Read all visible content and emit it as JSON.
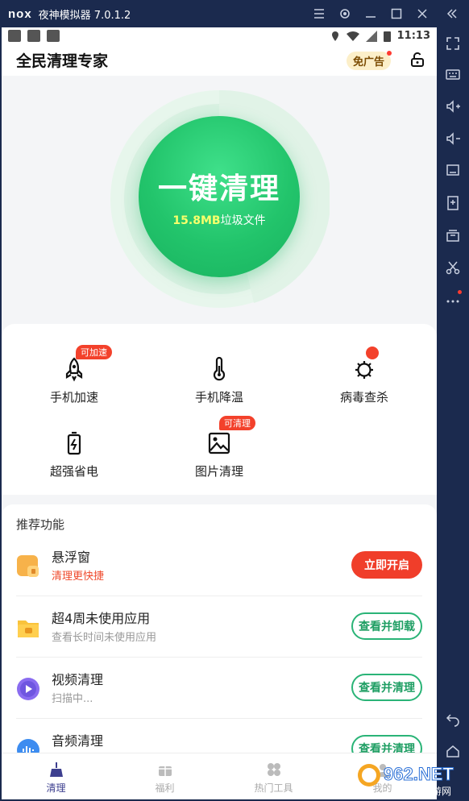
{
  "emulator": {
    "logo": "nox",
    "title": "夜神模拟器 7.0.1.2",
    "window_buttons": [
      "menu-icon",
      "settings-icon",
      "minimize-icon",
      "maximize-icon",
      "close-icon",
      "collapse-icon"
    ],
    "sidebar_icons": [
      "fullscreen-icon",
      "keyboard-icon",
      "volume-up-icon",
      "volume-down-icon",
      "screen-icon",
      "apk-install-icon",
      "multi-instance-icon",
      "screenshot-cut-icon",
      "more-icon",
      "back-icon",
      "home-icon"
    ]
  },
  "statusbar": {
    "time": "11:13"
  },
  "app": {
    "title": "全民清理专家",
    "no_ad_label": "免广告"
  },
  "hero": {
    "main_label": "一键清理",
    "junk_size": "15.8MB",
    "junk_suffix": "垃圾文件"
  },
  "tools": [
    {
      "label": "手机加速",
      "badge": "可加速",
      "icon": "rocket-icon"
    },
    {
      "label": "手机降温",
      "badge": "",
      "icon": "thermometer-icon"
    },
    {
      "label": "病毒查杀",
      "badge": "",
      "icon": "virus-icon",
      "dot": true
    },
    {
      "label": "超强省电",
      "badge": "",
      "icon": "battery-icon"
    },
    {
      "label": "图片清理",
      "badge": "可清理",
      "icon": "image-icon"
    }
  ],
  "recommend": {
    "title": "推荐功能",
    "items": [
      {
        "name": "悬浮窗",
        "desc": "清理更快捷",
        "action": "立即开启",
        "icon": "float-window-icon",
        "style": "red"
      },
      {
        "name": "超4周未使用应用",
        "desc": "查看长时间未使用应用",
        "action": "查看并卸载",
        "icon": "folder-app-icon",
        "style": "green"
      },
      {
        "name": "视频清理",
        "desc": "扫描中...",
        "action": "查看并清理",
        "icon": "video-icon",
        "style": "green"
      },
      {
        "name": "音频清理",
        "desc": "",
        "action": "查看并清理",
        "icon": "audio-icon",
        "style": "green"
      }
    ]
  },
  "bottom_nav": [
    {
      "label": "清理",
      "icon": "broom-icon",
      "active": true
    },
    {
      "label": "福利",
      "icon": "gift-icon",
      "active": false
    },
    {
      "label": "热门工具",
      "icon": "tools-grid-icon",
      "active": false
    },
    {
      "label": "我的",
      "icon": "profile-icon",
      "active": false
    }
  ],
  "watermark": {
    "text": "962.NET",
    "sub": "乐游网"
  },
  "colors": {
    "accent_green": "#22c46b",
    "accent_red": "#f03e2a",
    "emulator_bg": "#1b2a4e"
  }
}
